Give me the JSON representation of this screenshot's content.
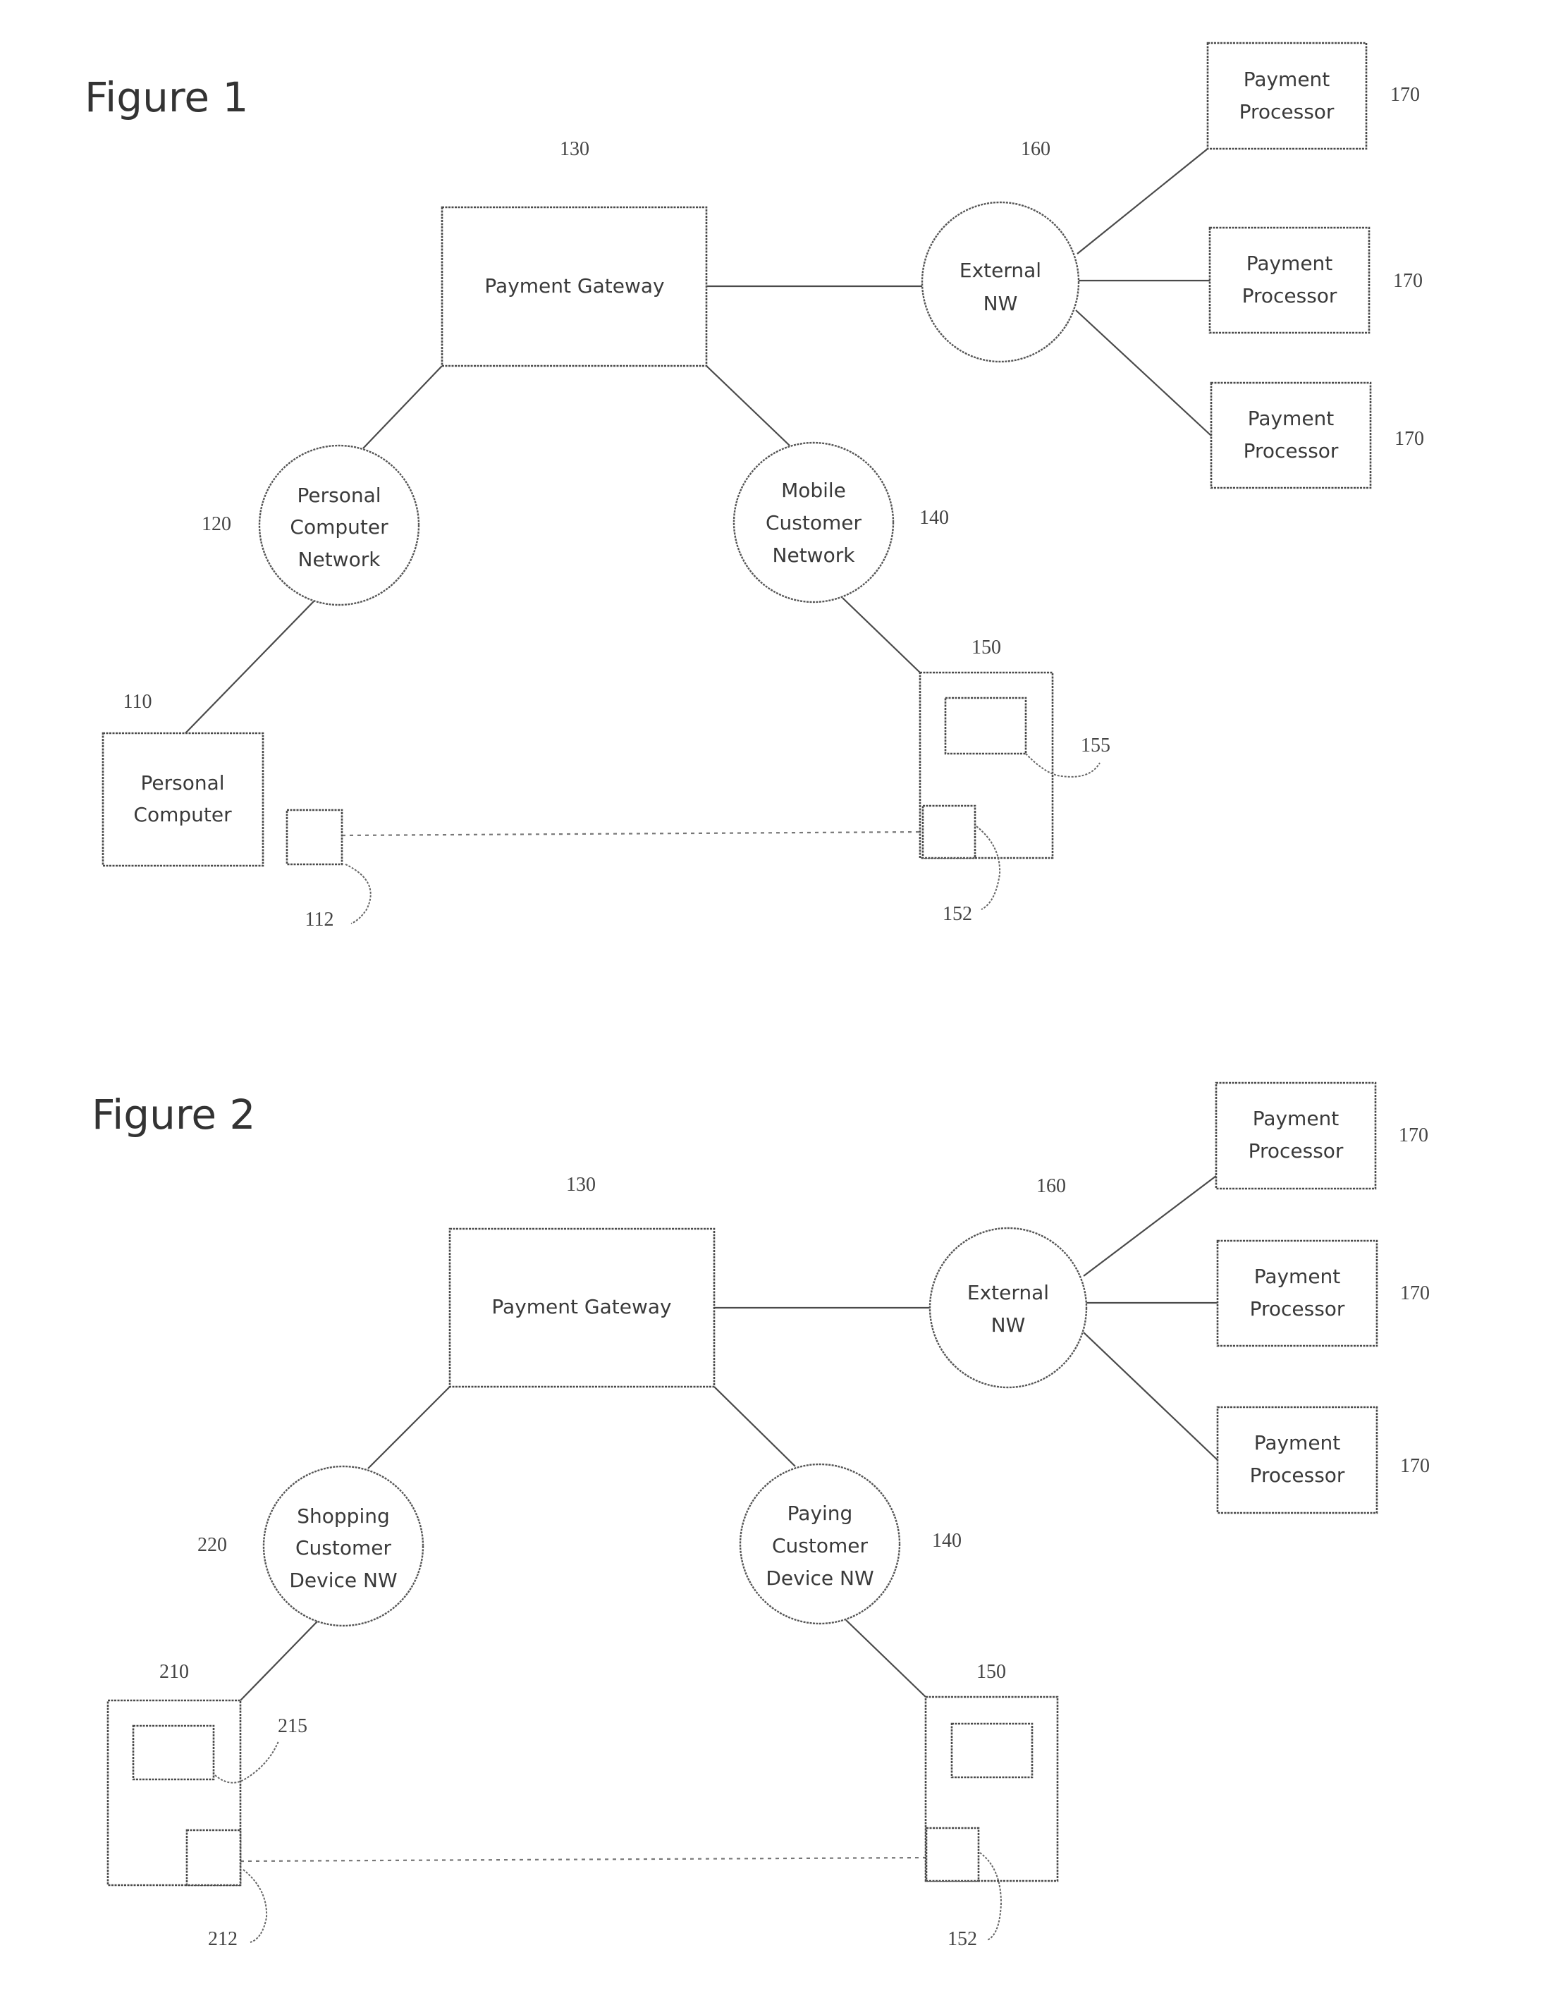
{
  "figures": [
    {
      "title": "Figure 1",
      "gateway": {
        "label": "Payment Gateway",
        "ref": "130"
      },
      "external_network": {
        "label_lines": [
          "External",
          "NW"
        ],
        "ref": "160"
      },
      "processors": [
        {
          "label_lines": [
            "Payment",
            "Processor"
          ],
          "ref": "170"
        },
        {
          "label_lines": [
            "Payment",
            "Processor"
          ],
          "ref": "170"
        },
        {
          "label_lines": [
            "Payment",
            "Processor"
          ],
          "ref": "170"
        }
      ],
      "left_network": {
        "label_lines": [
          "Personal",
          "Computer",
          "Network"
        ],
        "ref": "120"
      },
      "right_network": {
        "label_lines": [
          "Mobile",
          "Customer",
          "Network"
        ],
        "ref": "140"
      },
      "left_device": {
        "label_lines": [
          "Personal",
          "Computer"
        ],
        "ref": "110",
        "module_ref": "112"
      },
      "right_device": {
        "ref": "150",
        "screen_ref": "155",
        "module_ref": "152"
      }
    },
    {
      "title": "Figure 2",
      "gateway": {
        "label": "Payment Gateway",
        "ref": "130"
      },
      "external_network": {
        "label_lines": [
          "External",
          "NW"
        ],
        "ref": "160"
      },
      "processors": [
        {
          "label_lines": [
            "Payment",
            "Processor"
          ],
          "ref": "170"
        },
        {
          "label_lines": [
            "Payment",
            "Processor"
          ],
          "ref": "170"
        },
        {
          "label_lines": [
            "Payment",
            "Processor"
          ],
          "ref": "170"
        }
      ],
      "left_network": {
        "label_lines": [
          "Shopping",
          "Customer",
          "Device NW"
        ],
        "ref": "220"
      },
      "right_network": {
        "label_lines": [
          "Paying",
          "Customer",
          "Device NW"
        ],
        "ref": "140"
      },
      "left_device": {
        "ref": "210",
        "screen_ref": "215",
        "module_ref": "212"
      },
      "right_device": {
        "ref": "150",
        "module_ref": "152"
      }
    }
  ]
}
